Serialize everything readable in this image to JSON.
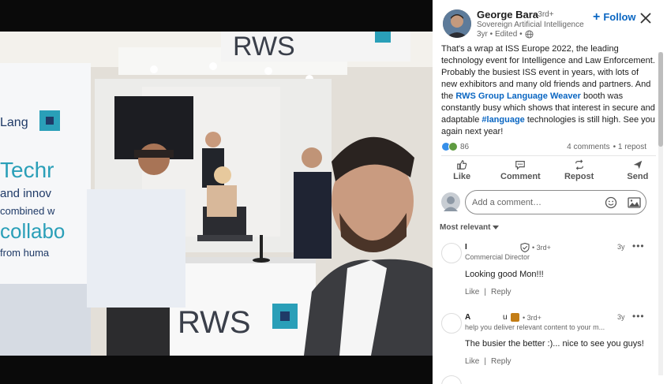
{
  "author": {
    "name": "George Bara",
    "degree": "• 3rd+",
    "headline": "Sovereign Artificial Intelligence",
    "time": "3yr • Edited •"
  },
  "follow_label": "Follow",
  "post": {
    "text_part1": "That's a wrap at ISS Europe 2022, the leading technology event for Intelligence and Law Enforcement. Probably the busiest ISS event in years, with lots of new exhibitors and many old friends and partners. And the ",
    "link1": "RWS Group",
    "text_part2": " ",
    "link2": "Language Weaver",
    "text_part3": " booth was constantly busy which shows that interest in secure and adaptable ",
    "hashtag": "#language",
    "text_part4": " technologies is still high. See you again next year!"
  },
  "reactions_count": "86",
  "comments_count": "4 comments",
  "reposts_count": "• 1 repost",
  "actions": {
    "like": "Like",
    "comment": "Comment",
    "repost": "Repost",
    "send": "Send"
  },
  "comment_placeholder": "Add a comment…",
  "sort_label": "Most relevant",
  "comments": [
    {
      "name": "I",
      "degree": "• 3rd+",
      "subtitle": "Commercial Director",
      "time": "3y",
      "text": "Looking good Mon!!!",
      "like": "Like",
      "reply": "Reply"
    },
    {
      "name": "A",
      "name_tail": "u",
      "degree": "• 3rd+",
      "subtitle": "help you deliver relevant content to your m...",
      "time": "3y",
      "text": "The busier the better :)... nice to see you guys!",
      "like": "Like",
      "reply": "Reply"
    }
  ],
  "photo": {
    "banner_text_lines": [
      "Techr",
      "and innov",
      "combined w",
      "collabo",
      "from huma"
    ],
    "banner_top": "Lang",
    "booth_brand": "RWS",
    "header_brand": "RWS"
  },
  "colors": {
    "accent": "#0a66c2",
    "brand_teal": "#2a9fb8",
    "brand_navy": "#1f3a67"
  }
}
